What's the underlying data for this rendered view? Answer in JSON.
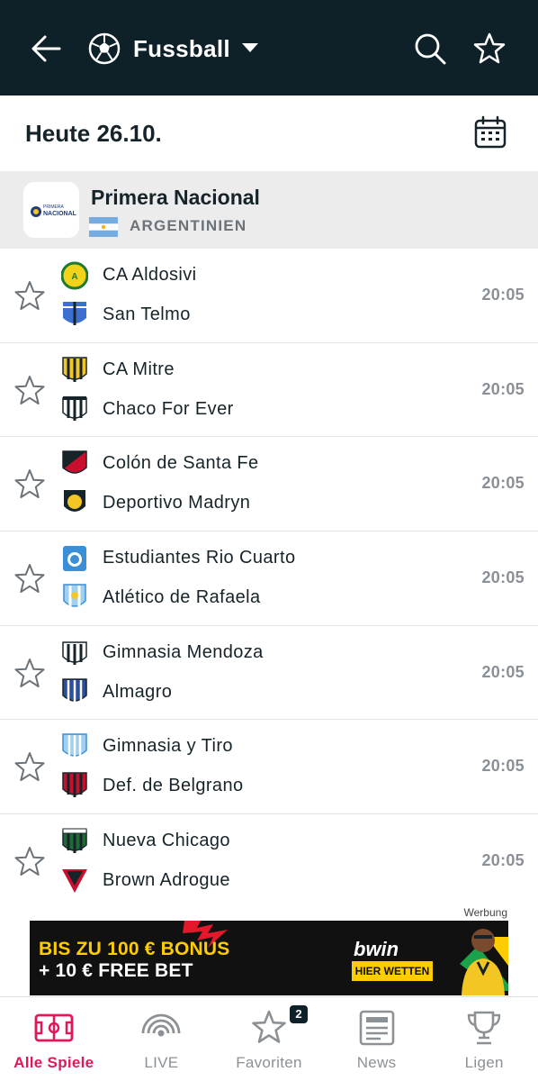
{
  "header": {
    "title": "Fussball",
    "accent_bg": "#0e2129"
  },
  "date_row": {
    "label": "Heute 26.10."
  },
  "league": {
    "name": "Primera Nacional",
    "country": "ARGENTINIEN",
    "logo_text_top": "PRIMERA",
    "logo_text_bottom": "NACIONAL"
  },
  "matches": [
    {
      "home": "CA Aldosivi",
      "away": "San Telmo",
      "time": "20:05",
      "home_crest": "aldosivi-crest",
      "away_crest": "san-telmo-crest"
    },
    {
      "home": "CA Mitre",
      "away": "Chaco For Ever",
      "time": "20:05",
      "home_crest": "mitre-crest",
      "away_crest": "chaco-crest"
    },
    {
      "home": "Colón de Santa Fe",
      "away": "Deportivo Madryn",
      "time": "20:05",
      "home_crest": "colon-crest",
      "away_crest": "madryn-crest"
    },
    {
      "home": "Estudiantes Rio Cuarto",
      "away": "Atlético de Rafaela",
      "time": "20:05",
      "home_crest": "estudiantes-crest",
      "away_crest": "rafaela-crest"
    },
    {
      "home": "Gimnasia Mendoza",
      "away": "Almagro",
      "time": "20:05",
      "home_crest": "gimnasia-mendoza-crest",
      "away_crest": "almagro-crest"
    },
    {
      "home": "Gimnasia y Tiro",
      "away": "Def. de Belgrano",
      "time": "20:05",
      "home_crest": "gimnasia-tiro-crest",
      "away_crest": "belgrano-crest"
    },
    {
      "home": "Nueva Chicago",
      "away": "Brown Adrogue",
      "time": "20:05",
      "home_crest": "nueva-chicago-crest",
      "away_crest": "brown-crest"
    }
  ],
  "ad": {
    "label": "Werbung",
    "line1": "BIS ZU 100 € BONUS",
    "line2": "+ 10 € FREE BET",
    "brand": "bwin",
    "cta": "HIER WETTEN"
  },
  "bottom_nav": {
    "items": [
      {
        "label": "Alle Spiele",
        "icon": "pitch-icon",
        "active": true
      },
      {
        "label": "LIVE",
        "icon": "live-icon",
        "active": false
      },
      {
        "label": "Favoriten",
        "icon": "star-icon",
        "active": false
      },
      {
        "label": "News",
        "icon": "news-icon",
        "active": false
      },
      {
        "label": "Ligen",
        "icon": "trophy-icon",
        "active": false
      }
    ],
    "favorites_badge": "2",
    "active_color": "#e0185a",
    "inactive_color": "#8c9195"
  }
}
